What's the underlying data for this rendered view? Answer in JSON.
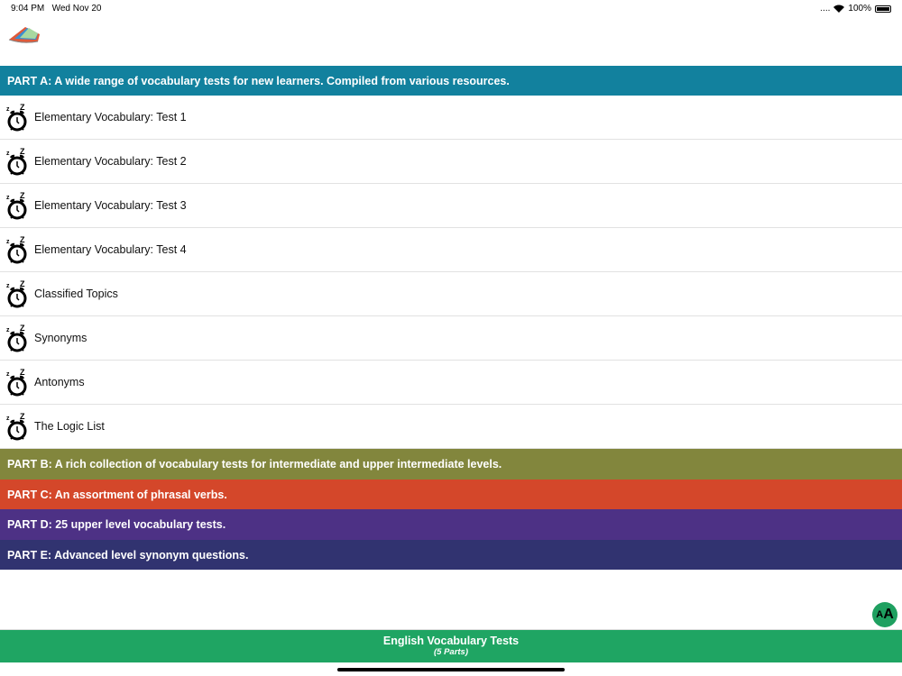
{
  "status": {
    "time": "9:04 PM",
    "date": "Wed Nov 20",
    "battery": "100%"
  },
  "parts": [
    {
      "label": "PART A: A wide range of vocabulary tests for new learners. Compiled from various resources.",
      "color": "#12819e"
    },
    {
      "label": "PART B: A rich collection of vocabulary tests for intermediate and upper intermediate levels.",
      "color": "#82863d"
    },
    {
      "label": "PART C: An assortment of phrasal verbs.",
      "color": "#d4472a"
    },
    {
      "label": "PART D: 25 upper level vocabulary tests.",
      "color": "#4d3185"
    },
    {
      "label": "PART E: Advanced level synonym questions.",
      "color": "#313370"
    }
  ],
  "items": [
    "Elementary Vocabulary: Test 1",
    "Elementary Vocabulary: Test 2",
    "Elementary Vocabulary: Test 3",
    "Elementary Vocabulary: Test 4",
    "Classified Topics",
    "Synonyms",
    "Antonyms",
    "The Logic List"
  ],
  "font_button": {
    "big": "A",
    "small": "A"
  },
  "footer": {
    "title": "English Vocabulary Tests",
    "subtitle": "(5 Parts)"
  }
}
